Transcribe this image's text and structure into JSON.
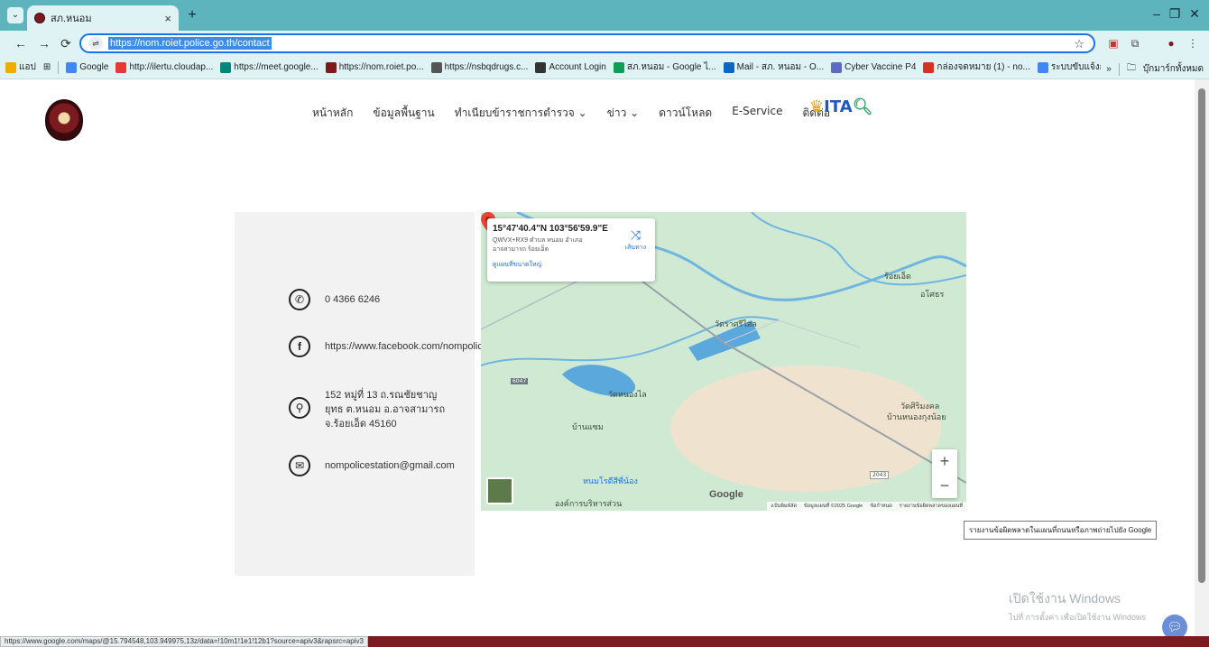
{
  "browser": {
    "tab_title": "สภ.หนอม",
    "tab_close": "×",
    "new_tab": "+",
    "url": "https://nom.roiet.police.go.th/contact",
    "bookmarks": [
      {
        "label": "แอป",
        "color": "#f2a900"
      },
      {
        "label": "Google",
        "color": "#4285f4"
      },
      {
        "label": "http://ilertu.cloudap...",
        "color": "#e53935"
      },
      {
        "label": "https://meet.google...",
        "color": "#00897b"
      },
      {
        "label": "https://nom.roiet.po...",
        "color": "#7b1a1f"
      },
      {
        "label": "https://nsbqdrugs.c...",
        "color": "#555555"
      },
      {
        "label": "Account Login",
        "color": "#333333"
      },
      {
        "label": "สภ.หนอม - Google ไ...",
        "color": "#0f9d58"
      },
      {
        "label": "Mail - สภ. หนอม - O...",
        "color": "#0a66c2"
      },
      {
        "label": "Cyber Vaccine P4",
        "color": "#5c6bc0"
      },
      {
        "label": "กล่องจดหมาย (1) - no...",
        "color": "#d93025"
      },
      {
        "label": "ระบบขับแจ้งการตามคุมตัว",
        "color": "#4285f4"
      }
    ],
    "bookmarks_overflow": "»",
    "all_bookmarks": "บุ๊กมาร์กทั้งหมด",
    "status_url": "https://www.google.com/maps/@15.794548,103.949975,13z/data=!10m1!1e1!12b1?source=apiv3&rapsrc=apiv3"
  },
  "nav": {
    "items": [
      "หน้าหลัก",
      "ข้อมูลพื้นฐาน",
      "ทำเนียบข้าราชการตำรวจ ⌄",
      "ข่าว ⌄",
      "ดาวน์โหลด",
      "E-Service",
      "ติดต่อ"
    ],
    "itac": "ITA"
  },
  "contact": {
    "phone": "0 4366 6246",
    "facebook": "https://www.facebook.com/nompolic",
    "address": [
      "152 หมู่ที่ 13 ถ.รณชัยชาญ",
      "ยุทธ ต.หนอม อ.อาจสามารถ",
      "จ.ร้อยเอ็ด 45160"
    ],
    "email": "nompolicestation@gmail.com"
  },
  "map": {
    "coord": "15°47'40.4\"N 103°56'59.9\"E",
    "plus_code": "QWVX+RX9 ตำบล หนอม อำเภอ อาจสามารถ ร้อยเอ็ด",
    "directions": "เส้นทาง",
    "bigger_map": "ดูแผนที่ขนาดใหญ่",
    "zoom_in": "+",
    "zoom_out": "−",
    "google": "Google",
    "labels": [
      "ร้อยเอ็ด",
      "อโศธร",
      "วัดราศรีไสล",
      "วัดหนองไล",
      "วัดศิริมงคล",
      "บ้านหนองกุงน้อย",
      "บ้านแซม",
      "หนมโรตีสีพี่น้อง",
      "องค์การบริหารส่วน",
      "6047",
      "2043"
    ],
    "attribution": [
      "แป้นพิมพ์ลัด",
      "ข้อมูลแผนที่ ©2025 Google",
      "ข้อกำหนด",
      "รายงานข้อผิดพลาดของแผนที่"
    ],
    "tooltip": "รายงานข้อผิดพลาดในแผนที่ถนนหรือภาพถ่ายไปยัง Google"
  },
  "windows": {
    "line1": "เปิดใช้งาน Windows",
    "line2": "ไปที่ การตั้งค่า เพื่อเปิดใช้งาน Windows"
  }
}
